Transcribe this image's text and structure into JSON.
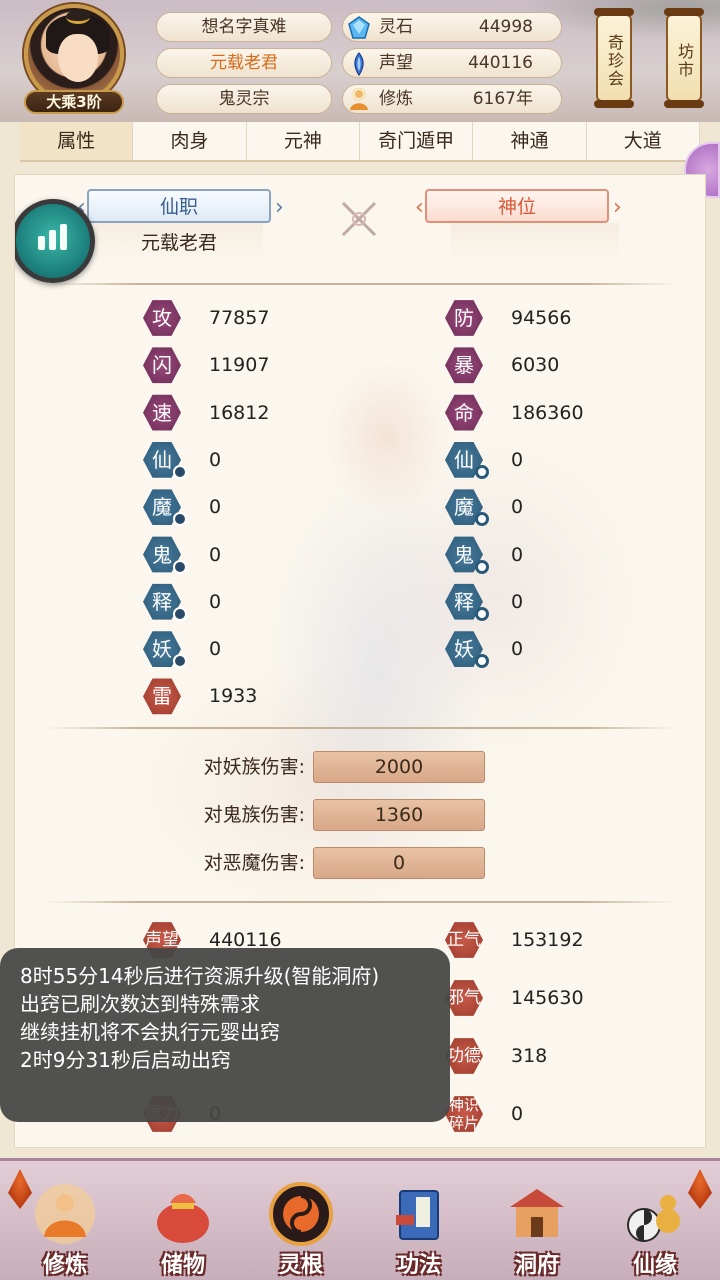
{
  "player": {
    "rank": "大乘3阶",
    "names": [
      "想名字真难",
      "元载老君",
      "鬼灵宗"
    ]
  },
  "resources": [
    {
      "label": "灵石",
      "value": "44998",
      "icon": "spirit-stone-icon",
      "color": "#4aa8e8"
    },
    {
      "label": "声望",
      "value": "440116",
      "icon": "reputation-icon",
      "color": "#3a7ad8"
    },
    {
      "label": "修炼",
      "value": "6167年",
      "icon": "cultivation-icon",
      "color": "#e8a040"
    }
  ],
  "side_buttons": [
    "奇珍会",
    "坊市"
  ],
  "tabs": [
    "属性",
    "肉身",
    "元神",
    "奇门遁甲",
    "神通",
    "大道"
  ],
  "titles": {
    "immortal_post_label": "仙职",
    "immortal_post_value": "元载老君",
    "divine_rank_label": "神位",
    "divine_rank_value": ""
  },
  "stats_left": [
    {
      "label": "攻",
      "value": "77857",
      "style": "purple",
      "mark": ""
    },
    {
      "label": "闪",
      "value": "11907",
      "style": "purple",
      "mark": ""
    },
    {
      "label": "速",
      "value": "16812",
      "style": "purple",
      "mark": ""
    },
    {
      "label": "仙",
      "value": "0",
      "style": "blue",
      "mark": "i"
    },
    {
      "label": "魔",
      "value": "0",
      "style": "blue",
      "mark": "i"
    },
    {
      "label": "鬼",
      "value": "0",
      "style": "blue",
      "mark": "i"
    },
    {
      "label": "释",
      "value": "0",
      "style": "blue",
      "mark": "i"
    },
    {
      "label": "妖",
      "value": "0",
      "style": "blue",
      "mark": "i"
    },
    {
      "label": "雷",
      "value": "1933",
      "style": "red",
      "mark": ""
    }
  ],
  "stats_right": [
    {
      "label": "防",
      "value": "94566",
      "style": "purple",
      "mark": ""
    },
    {
      "label": "暴",
      "value": "6030",
      "style": "purple",
      "mark": ""
    },
    {
      "label": "命",
      "value": "186360",
      "style": "purple",
      "mark": ""
    },
    {
      "label": "仙",
      "value": "0",
      "style": "blue",
      "mark": "o"
    },
    {
      "label": "魔",
      "value": "0",
      "style": "blue",
      "mark": "o"
    },
    {
      "label": "鬼",
      "value": "0",
      "style": "blue",
      "mark": "o"
    },
    {
      "label": "释",
      "value": "0",
      "style": "blue",
      "mark": "o"
    },
    {
      "label": "妖",
      "value": "0",
      "style": "blue",
      "mark": "o"
    }
  ],
  "damage": [
    {
      "label": "对妖族伤害:",
      "value": "2000"
    },
    {
      "label": "对鬼族伤害:",
      "value": "1360"
    },
    {
      "label": "对恶魔伤害:",
      "value": "0"
    }
  ],
  "bottom_stats_left": [
    {
      "label": "声望",
      "value": "440116"
    },
    {
      "label": "愿力",
      "value": "0"
    }
  ],
  "bottom_stats_right": [
    {
      "label": "正气",
      "value": "153192"
    },
    {
      "label": "邪气",
      "value": "145630"
    },
    {
      "label": "功德",
      "value": "318"
    },
    {
      "label": "神识碎片",
      "value": "0"
    }
  ],
  "toast": [
    "8时55分14秒后进行资源升级(智能洞府)",
    "出窍已刷次数达到特殊需求",
    "继续挂机将不会执行元婴出窍",
    "2时9分31秒后启动出窍"
  ],
  "bottom_nav": [
    {
      "label": "修炼",
      "icon": "meditating-monk-icon"
    },
    {
      "label": "储物",
      "icon": "treasure-bag-icon"
    },
    {
      "label": "灵根",
      "icon": "spirit-root-icon"
    },
    {
      "label": "功法",
      "icon": "scripture-book-icon"
    },
    {
      "label": "洞府",
      "icon": "cave-palace-icon"
    },
    {
      "label": "仙缘",
      "icon": "gourd-fortune-icon"
    }
  ]
}
